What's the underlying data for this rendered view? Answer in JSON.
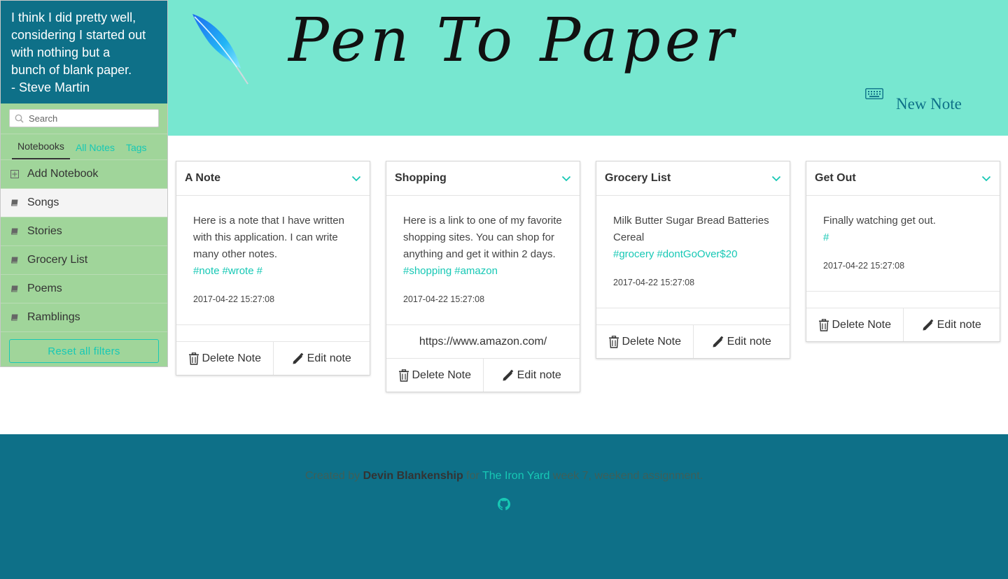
{
  "sidebar": {
    "quote_lines": [
      "I think I did pretty well,",
      "considering I started out",
      "with nothing but a",
      "bunch of blank paper.",
      "- Steve Martin"
    ],
    "search_placeholder": "Search",
    "tabs": [
      {
        "label": "Notebooks",
        "active": true
      },
      {
        "label": "All Notes",
        "active": false
      },
      {
        "label": "Tags",
        "active": false
      }
    ],
    "add_notebook_label": "Add Notebook",
    "notebooks": [
      {
        "label": "Songs",
        "selected": true
      },
      {
        "label": "Stories",
        "selected": false
      },
      {
        "label": "Grocery List",
        "selected": false
      },
      {
        "label": "Poems",
        "selected": false
      },
      {
        "label": "Ramblings",
        "selected": false
      }
    ],
    "reset_label": "Reset all filters"
  },
  "header": {
    "title": "Pen To Paper",
    "new_note_label": "New Note",
    "accent": "#77e7d0"
  },
  "notes": [
    {
      "title": "A Note",
      "body": "Here is a note that I have written with this application. I can write many other notes.",
      "tags": [
        "#note",
        "#wrote",
        "#"
      ],
      "timestamp": "2017-04-22 15:27:08",
      "link": "",
      "delete_label": "Delete Note",
      "edit_label": "Edit note"
    },
    {
      "title": "Shopping",
      "body": "Here is a link to one of my favorite shopping sites. You can shop for anything and get it within 2 days.",
      "tags": [
        "#shopping",
        "#amazon"
      ],
      "timestamp": "2017-04-22 15:27:08",
      "link": "https://www.amazon.com/",
      "delete_label": "Delete Note",
      "edit_label": "Edit note"
    },
    {
      "title": "Grocery List",
      "body": "Milk Butter Sugar Bread Batteries Cereal",
      "tags": [
        "#grocery",
        "#dontGoOver$20"
      ],
      "timestamp": "2017-04-22 15:27:08",
      "link": "",
      "delete_label": "Delete Note",
      "edit_label": "Edit note"
    },
    {
      "title": "Get Out",
      "body": "Finally watching get out.",
      "tags": [
        "#"
      ],
      "timestamp": "2017-04-22 15:27:08",
      "link": "",
      "delete_label": "Delete Note",
      "edit_label": "Edit note"
    }
  ],
  "footer": {
    "prefix": "Created by ",
    "author": "Devin Blankenship",
    "middle": " for ",
    "school": "The Iron Yard",
    "suffix": " week 7, weekend assignment.",
    "icon": "github-icon"
  },
  "colors": {
    "teal_dark": "#0e7088",
    "teal_accent": "#17c8b5",
    "sidebar_green": "#a0d59a",
    "header_mint": "#77e7d0"
  }
}
